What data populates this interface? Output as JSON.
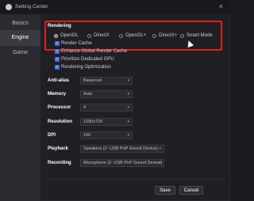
{
  "window": {
    "title": "Setting Center"
  },
  "sidebar": {
    "items": [
      {
        "label": "Basics",
        "active": false
      },
      {
        "label": "Engine",
        "active": true
      },
      {
        "label": "Game",
        "active": false
      }
    ]
  },
  "rendering": {
    "label": "Rendering",
    "options": [
      {
        "label": "OpenGL",
        "selected": true
      },
      {
        "label": "DirectX",
        "selected": false
      },
      {
        "label": "OpenGL+",
        "selected": false
      },
      {
        "label": "DirectX+",
        "selected": false
      },
      {
        "label": "Smart Mode",
        "selected": false
      }
    ]
  },
  "checkboxes": [
    {
      "label": "Render Cache",
      "checked": true
    },
    {
      "label": "Enhance Global Render Cache",
      "checked": true
    },
    {
      "label": "Prioritize Dedicated GPU",
      "checked": true
    },
    {
      "label": "Rendering Optimization",
      "checked": true
    }
  ],
  "settings": [
    {
      "label": "Anti-alias",
      "value": "Balanced"
    },
    {
      "label": "Memory",
      "value": "Auto"
    },
    {
      "label": "Processor",
      "value": "4"
    },
    {
      "label": "Resolution",
      "value": "1280x720"
    },
    {
      "label": "DPI",
      "value": "160"
    },
    {
      "label": "Playback",
      "value": "Speakers (2- USB PnP Sound Device)"
    },
    {
      "label": "Recording",
      "value": "Microphone (2- USB PnP Sound Device)"
    }
  ],
  "buttons": {
    "save": "Save",
    "cancel": "Cancel"
  },
  "colors": {
    "highlight": "#e41c1c",
    "accent": "#4a6ee0",
    "background": "#1f1f24",
    "sidebar": "#2a2a30"
  }
}
